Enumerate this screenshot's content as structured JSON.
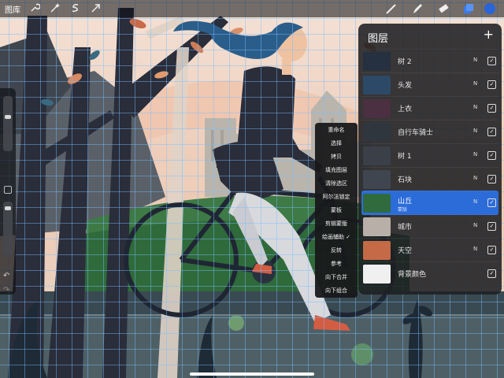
{
  "topbar": {
    "gallery_label": "图库",
    "left_tools": [
      "wrench-icon",
      "magic-wand-icon",
      "selection-icon",
      "transform-arrow-icon"
    ],
    "right_tools": [
      "brush-icon",
      "smudge-icon",
      "eraser-icon",
      "layers-icon",
      "color-icon"
    ],
    "active_color": "#2a64d6"
  },
  "layers_panel": {
    "title": "图层",
    "add_label": "+",
    "layers": [
      {
        "name": "树 2",
        "blend": "N",
        "visible": "✓",
        "thumb_color": "#253040"
      },
      {
        "name": "头发",
        "blend": "N",
        "visible": "✓",
        "thumb_color": "#2d4968"
      },
      {
        "name": "上衣",
        "blend": "N",
        "visible": "✓",
        "thumb_color": "#4a3040"
      },
      {
        "name": "自行车骑士",
        "blend": "N",
        "visible": "✓",
        "thumb_color": "#30363e"
      },
      {
        "name": "树 1",
        "blend": "N",
        "visible": "✓",
        "thumb_color": "#3a3f48"
      },
      {
        "name": "石块",
        "blend": "N",
        "visible": "✓",
        "thumb_color": "#3f4650"
      },
      {
        "name": "山丘",
        "sublabel": "蒙版",
        "blend": "N",
        "visible": "✓",
        "thumb_color": "#2f6b3c",
        "active": true
      },
      {
        "name": "城市",
        "blend": "N",
        "visible": "✓",
        "thumb_color": "#b8b0a8"
      },
      {
        "name": "天空",
        "blend": "N",
        "visible": "✓",
        "thumb_color": "#c46a47"
      },
      {
        "name": "背景颜色",
        "blend": "",
        "visible": "✓",
        "thumb_color": "#f0f0f0"
      }
    ]
  },
  "context_menu": {
    "items": [
      "重命名",
      "选择",
      "拷贝",
      "填充图层",
      "清除选区",
      "阿尔法锁定",
      "蒙板",
      "剪辑蒙版",
      "绘画辅助 ✓",
      "反转",
      "参考",
      "向下合并",
      "向下组合"
    ]
  },
  "colors": {
    "accent": "#2c6cd9",
    "panel_bg": "#1e1f22",
    "grid": "#78beff"
  }
}
